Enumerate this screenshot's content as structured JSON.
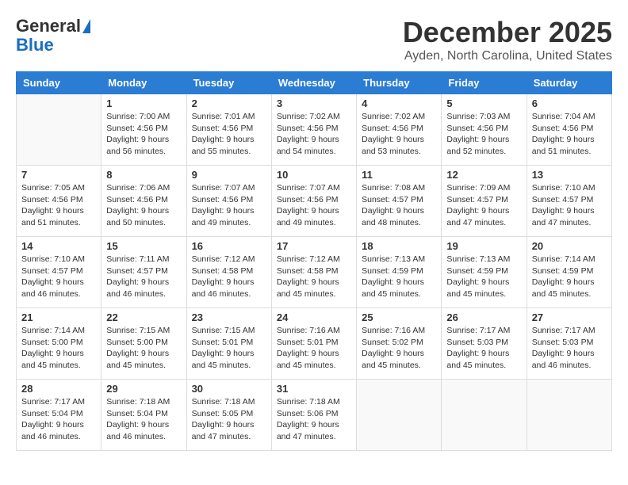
{
  "header": {
    "logo": {
      "general": "General",
      "blue": "Blue"
    },
    "title": "December 2025",
    "location": "Ayden, North Carolina, United States"
  },
  "calendar": {
    "days_of_week": [
      "Sunday",
      "Monday",
      "Tuesday",
      "Wednesday",
      "Thursday",
      "Friday",
      "Saturday"
    ],
    "weeks": [
      [
        {
          "day": "",
          "info": ""
        },
        {
          "day": "1",
          "info": "Sunrise: 7:00 AM\nSunset: 4:56 PM\nDaylight: 9 hours\nand 56 minutes."
        },
        {
          "day": "2",
          "info": "Sunrise: 7:01 AM\nSunset: 4:56 PM\nDaylight: 9 hours\nand 55 minutes."
        },
        {
          "day": "3",
          "info": "Sunrise: 7:02 AM\nSunset: 4:56 PM\nDaylight: 9 hours\nand 54 minutes."
        },
        {
          "day": "4",
          "info": "Sunrise: 7:02 AM\nSunset: 4:56 PM\nDaylight: 9 hours\nand 53 minutes."
        },
        {
          "day": "5",
          "info": "Sunrise: 7:03 AM\nSunset: 4:56 PM\nDaylight: 9 hours\nand 52 minutes."
        },
        {
          "day": "6",
          "info": "Sunrise: 7:04 AM\nSunset: 4:56 PM\nDaylight: 9 hours\nand 51 minutes."
        }
      ],
      [
        {
          "day": "7",
          "info": "Sunrise: 7:05 AM\nSunset: 4:56 PM\nDaylight: 9 hours\nand 51 minutes."
        },
        {
          "day": "8",
          "info": "Sunrise: 7:06 AM\nSunset: 4:56 PM\nDaylight: 9 hours\nand 50 minutes."
        },
        {
          "day": "9",
          "info": "Sunrise: 7:07 AM\nSunset: 4:56 PM\nDaylight: 9 hours\nand 49 minutes."
        },
        {
          "day": "10",
          "info": "Sunrise: 7:07 AM\nSunset: 4:56 PM\nDaylight: 9 hours\nand 49 minutes."
        },
        {
          "day": "11",
          "info": "Sunrise: 7:08 AM\nSunset: 4:57 PM\nDaylight: 9 hours\nand 48 minutes."
        },
        {
          "day": "12",
          "info": "Sunrise: 7:09 AM\nSunset: 4:57 PM\nDaylight: 9 hours\nand 47 minutes."
        },
        {
          "day": "13",
          "info": "Sunrise: 7:10 AM\nSunset: 4:57 PM\nDaylight: 9 hours\nand 47 minutes."
        }
      ],
      [
        {
          "day": "14",
          "info": "Sunrise: 7:10 AM\nSunset: 4:57 PM\nDaylight: 9 hours\nand 46 minutes."
        },
        {
          "day": "15",
          "info": "Sunrise: 7:11 AM\nSunset: 4:57 PM\nDaylight: 9 hours\nand 46 minutes."
        },
        {
          "day": "16",
          "info": "Sunrise: 7:12 AM\nSunset: 4:58 PM\nDaylight: 9 hours\nand 46 minutes."
        },
        {
          "day": "17",
          "info": "Sunrise: 7:12 AM\nSunset: 4:58 PM\nDaylight: 9 hours\nand 45 minutes."
        },
        {
          "day": "18",
          "info": "Sunrise: 7:13 AM\nSunset: 4:59 PM\nDaylight: 9 hours\nand 45 minutes."
        },
        {
          "day": "19",
          "info": "Sunrise: 7:13 AM\nSunset: 4:59 PM\nDaylight: 9 hours\nand 45 minutes."
        },
        {
          "day": "20",
          "info": "Sunrise: 7:14 AM\nSunset: 4:59 PM\nDaylight: 9 hours\nand 45 minutes."
        }
      ],
      [
        {
          "day": "21",
          "info": "Sunrise: 7:14 AM\nSunset: 5:00 PM\nDaylight: 9 hours\nand 45 minutes."
        },
        {
          "day": "22",
          "info": "Sunrise: 7:15 AM\nSunset: 5:00 PM\nDaylight: 9 hours\nand 45 minutes."
        },
        {
          "day": "23",
          "info": "Sunrise: 7:15 AM\nSunset: 5:01 PM\nDaylight: 9 hours\nand 45 minutes."
        },
        {
          "day": "24",
          "info": "Sunrise: 7:16 AM\nSunset: 5:01 PM\nDaylight: 9 hours\nand 45 minutes."
        },
        {
          "day": "25",
          "info": "Sunrise: 7:16 AM\nSunset: 5:02 PM\nDaylight: 9 hours\nand 45 minutes."
        },
        {
          "day": "26",
          "info": "Sunrise: 7:17 AM\nSunset: 5:03 PM\nDaylight: 9 hours\nand 45 minutes."
        },
        {
          "day": "27",
          "info": "Sunrise: 7:17 AM\nSunset: 5:03 PM\nDaylight: 9 hours\nand 46 minutes."
        }
      ],
      [
        {
          "day": "28",
          "info": "Sunrise: 7:17 AM\nSunset: 5:04 PM\nDaylight: 9 hours\nand 46 minutes."
        },
        {
          "day": "29",
          "info": "Sunrise: 7:18 AM\nSunset: 5:04 PM\nDaylight: 9 hours\nand 46 minutes."
        },
        {
          "day": "30",
          "info": "Sunrise: 7:18 AM\nSunset: 5:05 PM\nDaylight: 9 hours\nand 47 minutes."
        },
        {
          "day": "31",
          "info": "Sunrise: 7:18 AM\nSunset: 5:06 PM\nDaylight: 9 hours\nand 47 minutes."
        },
        {
          "day": "",
          "info": ""
        },
        {
          "day": "",
          "info": ""
        },
        {
          "day": "",
          "info": ""
        }
      ]
    ]
  }
}
